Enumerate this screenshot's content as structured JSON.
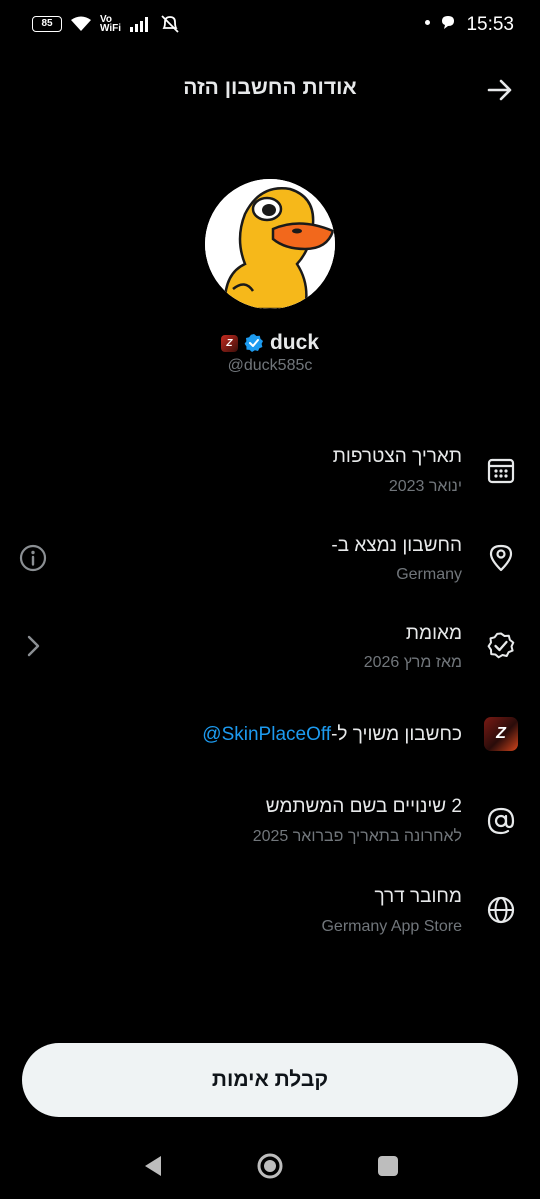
{
  "status_bar": {
    "battery": "85",
    "vowifi_top": "Vo",
    "vowifi_bottom": "WiFi",
    "time": "15:53"
  },
  "header": {
    "title": "אודות החשבון הזה"
  },
  "profile": {
    "display_name": "duck",
    "handle": "@duck585c",
    "brand_badge": "Z"
  },
  "rows": {
    "joined": {
      "title": "תאריך הצטרפות",
      "value": "ינואר 2023"
    },
    "location": {
      "title": "החשבון נמצא ב-",
      "value": "Germany"
    },
    "verified": {
      "title": "מאומת",
      "value": "מאז מרץ 2026"
    },
    "affiliate": {
      "prefix": "כחשבון משויך ל-",
      "link": "@SkinPlaceOff",
      "tile": "Z"
    },
    "username": {
      "title": "2 שינויים בשם המשתמש",
      "value": "לאחרונה בתאריך פברואר 2025"
    },
    "connected": {
      "title": "מחובר דרך",
      "value": "Germany App Store"
    }
  },
  "footer": {
    "verify_button": "קבלת אימות"
  },
  "colors": {
    "background": "#000000",
    "accent": "#1d9bf0",
    "button_bg": "#eff3f4",
    "secondary_text": "#71767b"
  }
}
